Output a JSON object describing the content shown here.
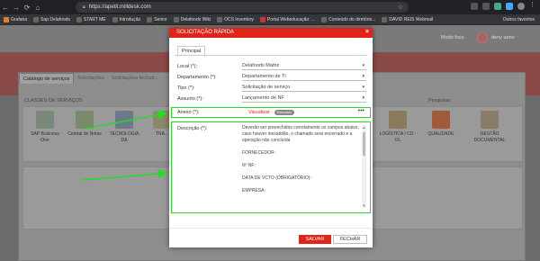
{
  "browser": {
    "url": "https://apetit.milldesk.com",
    "bookmarks": [
      "Grafana",
      "Sap Delafoods",
      "START ME",
      "Introdução",
      "Senior",
      "Delafoods Wiki",
      "OCS Inventory",
      "Portal Webeducação: ...",
      "Conteúdo do diretório...",
      "DAVID REIS Webmail"
    ],
    "other_bookmarks": "Outros favoritos"
  },
  "app": {
    "modo_foco": "Modo foco",
    "user_name": "deny ueno",
    "tabs": [
      "Catálogo de serviços",
      "Solicitações",
      "Solicitações fechad..."
    ],
    "classes_title": "CLASSES DE SERVIÇOS",
    "pesquisar": "Pesquisar",
    "services": [
      {
        "label": "SAP Business One",
        "icon": "sap-icon"
      },
      {
        "label": "Central de Notas",
        "icon": "notes-icon"
      },
      {
        "label": "TECNOLOGIA DA",
        "icon": "network-icon"
      },
      {
        "label": "TRA...",
        "icon": "transport-icon"
      },
      {
        "label": "LOGÍSTICA / CD - OL",
        "icon": "box-icon"
      },
      {
        "label": "QUALIDADE",
        "icon": "quality-icon"
      },
      {
        "label": "GESTÃO DOCUMENTAL",
        "icon": "document-icon"
      }
    ]
  },
  "modal": {
    "title": "SOLICITAÇÃO RÁPIDA",
    "close": "×",
    "tab": "Principal",
    "fields": [
      {
        "label": "Local (*):",
        "value": "Delafoods Matriz"
      },
      {
        "label": "Departamento (*):",
        "value": "Departamento de TI"
      },
      {
        "label": "Tipo (*):",
        "value": "Solicitação de serviço"
      },
      {
        "label": "Assunto (*):",
        "value": "Lançamento de NF"
      },
      {
        "label": "Anexo (*):",
        "value": "Visualizar"
      },
      {
        "label": "Descrição (*):",
        "value": ""
      }
    ],
    "anexo_badge": "Executar",
    "anexo_menu": "•••",
    "description": [
      "Deverão ser preenchidos corretamente os campos abaixo, caso houver inexatidão, o chamado será encerrado e a operação não concluída",
      "FORNECEDOR:",
      "Nº NF:",
      "DATA DE VCTO (OBRIGATÓRIO):",
      "EMPRESA:"
    ],
    "save_label": "SALVAR",
    "close_label": "FECHAR"
  },
  "colors": {
    "accent": "#e02418",
    "highlight": "#22dd22"
  }
}
